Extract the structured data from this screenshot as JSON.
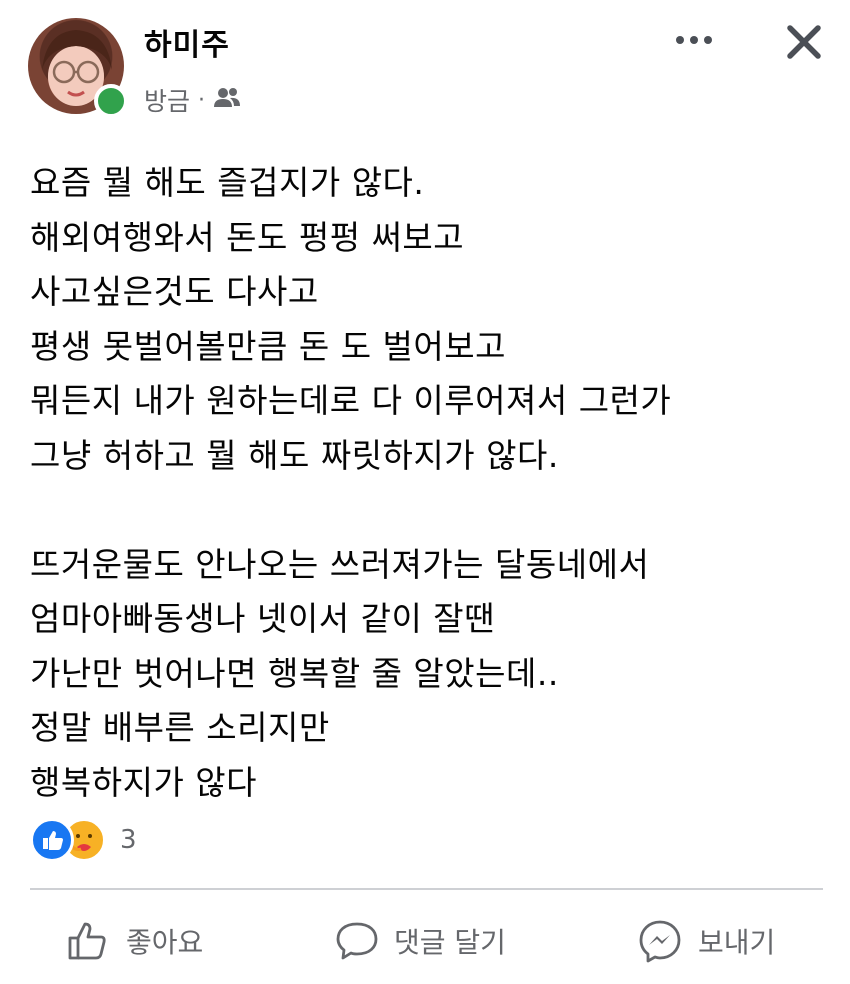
{
  "post": {
    "author": "하미주",
    "timestamp": "방금",
    "separator": "·",
    "audience_icon": "friends-icon",
    "online_status_color": "#31a24c",
    "body": "요즘 뭘 해도 즐겁지가 않다.\n해외여행와서 돈도 펑펑 써보고\n사고싶은것도 다사고\n평생 못벌어볼만큼 돈 도 벌어보고\n뭐든지 내가 원하는데로 다 이루어져서 그런가\n그냥 허하고 뭘 해도 짜릿하지가 않다.\n\n뜨거운물도 안나오는 쓰러져가는 달동네에서\n엄마아빠동생나 넷이서 같이 잘땐\n가난만 벗어나면 행복할 줄 알았는데..\n정말 배부른 소리지만\n행복하지가 않다"
  },
  "reactions": {
    "types": [
      "like",
      "care"
    ],
    "count": "3",
    "like_color": "#1877f2",
    "care_color": "#f7b125"
  },
  "header_buttons": {
    "more_icon": "more-horizontal-icon",
    "close_icon": "close-icon"
  },
  "actions": {
    "like_label": "좋아요",
    "comment_label": "댓글 달기",
    "send_label": "보내기"
  }
}
